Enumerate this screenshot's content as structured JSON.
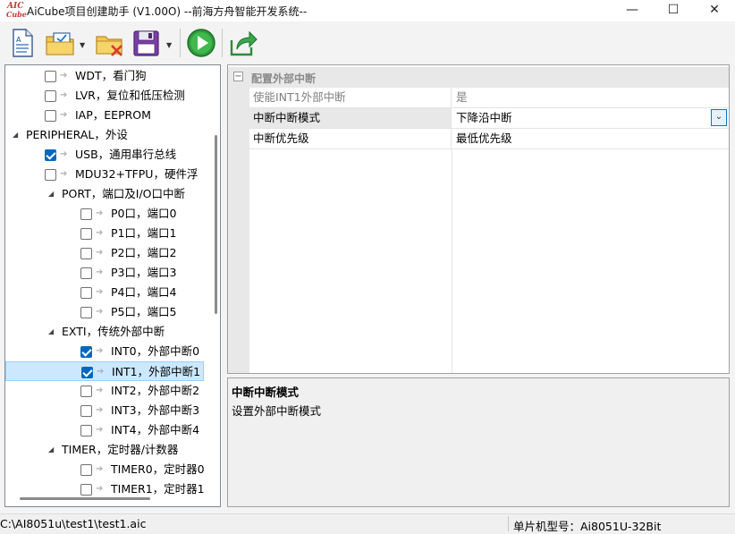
{
  "window": {
    "title": "AiCube项目创建助手 (V1.00O) --前海方舟智能开发系统--",
    "logo_text_top": "AIC",
    "logo_text_bottom": "Cube",
    "minimize_glyph": "—",
    "maximize_glyph": "☐",
    "close_glyph": "✕"
  },
  "toolbar": {
    "buttons": [
      {
        "icon": "new-document-icon"
      },
      {
        "icon": "open-folder-icon"
      },
      {
        "icon": "close-folder-icon"
      },
      {
        "icon": "save-disk-icon"
      },
      {
        "icon": "run-icon"
      },
      {
        "icon": "export-icon"
      }
    ],
    "dropdown_glyph": "▼"
  },
  "tree": {
    "items": [
      {
        "label": "WDT，看门狗",
        "checked": false,
        "level": 2
      },
      {
        "label": "LVR，复位和低压检测",
        "checked": false,
        "level": 2
      },
      {
        "label": "IAP，EEPROM",
        "checked": false,
        "level": 2
      },
      {
        "label": "PERIPHERAL，外设",
        "level": 0,
        "expander": "◢"
      },
      {
        "label": "USB，通用串行总线",
        "checked": true,
        "level": 2
      },
      {
        "label": "MDU32+TFPU，硬件浮",
        "checked": false,
        "level": 2
      },
      {
        "label": "PORT，端口及I/O口中断",
        "level": 1,
        "expander": "◢"
      },
      {
        "label": "P0口，端口0",
        "checked": false,
        "level": 3
      },
      {
        "label": "P1口，端口1",
        "checked": false,
        "level": 3
      },
      {
        "label": "P2口，端口2",
        "checked": false,
        "level": 3
      },
      {
        "label": "P3口，端口3",
        "checked": false,
        "level": 3
      },
      {
        "label": "P4口，端口4",
        "checked": false,
        "level": 3
      },
      {
        "label": "P5口，端口5",
        "checked": false,
        "level": 3
      },
      {
        "label": "EXTI，传统外部中断",
        "level": 1,
        "expander": "◢"
      },
      {
        "label": "INT0，外部中断0",
        "checked": true,
        "level": 3
      },
      {
        "label": "INT1，外部中断1",
        "checked": true,
        "level": 3,
        "selected": true
      },
      {
        "label": "INT2，外部中断2",
        "checked": false,
        "level": 3
      },
      {
        "label": "INT3，外部中断3",
        "checked": false,
        "level": 3
      },
      {
        "label": "INT4，外部中断4",
        "checked": false,
        "level": 3
      },
      {
        "label": "TIMER，定时器/计数器",
        "level": 1,
        "expander": "◢"
      },
      {
        "label": "TIMER0，定时器0",
        "checked": false,
        "level": 3
      },
      {
        "label": "TIMER1，定时器1",
        "checked": false,
        "level": 3
      }
    ]
  },
  "property_grid": {
    "category": "配置外部中断",
    "category_toggle": "⊟",
    "rows": [
      {
        "name": "使能INT1外部中断",
        "value": "是",
        "readonly": true
      },
      {
        "name": "中断中断模式",
        "value": "下降沿中断",
        "selected": true,
        "combo": true
      },
      {
        "name": "中断优先级",
        "value": "最低优先级"
      }
    ],
    "combo_glyph": "⌄"
  },
  "description": {
    "title": "中断中断模式",
    "text": "设置外部中断模式"
  },
  "statusbar": {
    "path": "C:\\AI8051u\\test1\\test1.aic",
    "chip": "单片机型号：Ai8051U-32Bit"
  },
  "colors": {
    "accent": "#0067c0",
    "selection": "#cce8ff",
    "run_green": "#2e9c3c"
  }
}
